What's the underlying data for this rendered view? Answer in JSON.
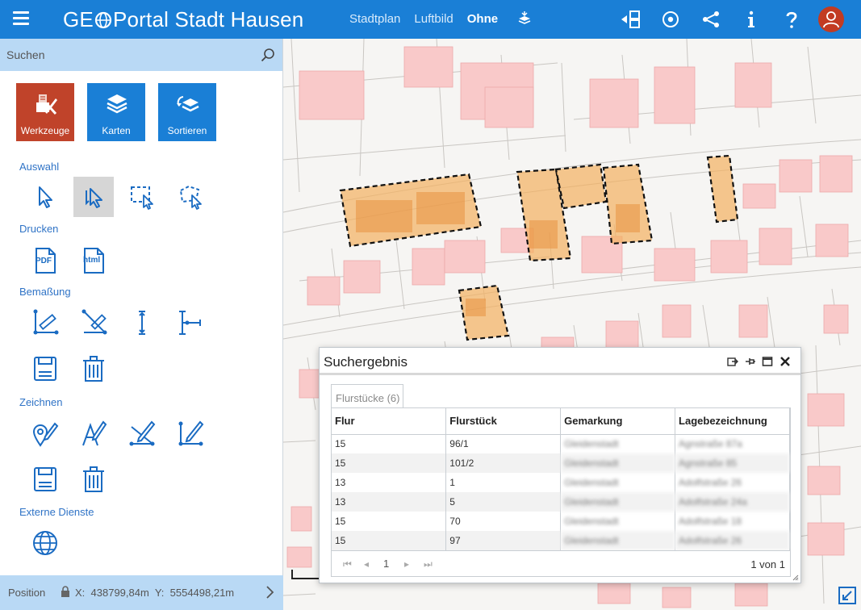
{
  "header": {
    "brand_prefix": "GE",
    "brand_suffix": "Portal Stadt Hausen",
    "nav": [
      {
        "label": "Stadtplan",
        "active": false
      },
      {
        "label": "Luftbild",
        "active": false
      },
      {
        "label": "Ohne",
        "active": true
      }
    ],
    "icons": [
      "menu-icon",
      "layers-icon",
      "panel-toggle-icon",
      "target-icon",
      "share-icon",
      "info-icon",
      "help-icon",
      "user-icon"
    ]
  },
  "search": {
    "placeholder": "Suchen"
  },
  "tabs": [
    {
      "label": "Werkzeuge",
      "color": "#c0432a"
    },
    {
      "label": "Karten",
      "color": "#1a7fd6"
    },
    {
      "label": "Sortieren",
      "color": "#1a7fd6"
    }
  ],
  "sections": {
    "auswahl": "Auswahl",
    "drucken": "Drucken",
    "bemassung": "Bemaßung",
    "zeichnen": "Zeichnen",
    "externe": "Externe Dienste"
  },
  "print_labels": {
    "pdf": "PDF",
    "html": "html"
  },
  "status": {
    "label": "Position",
    "x_label": "X:",
    "x_value": "438799,84m",
    "y_label": "Y:",
    "y_value": "5554498,21m"
  },
  "dialog": {
    "title": "Suchergebnis",
    "tab_label": "Flurstücke (6)",
    "columns": [
      "Flur",
      "Flurstück",
      "Gemarkung",
      "Lagebezeichnung"
    ],
    "rows": [
      {
        "flur": "15",
        "flurstueck": "96/1",
        "gemarkung": "Gleidenstadt",
        "lage": "Agnstraße 87a"
      },
      {
        "flur": "15",
        "flurstueck": "101/2",
        "gemarkung": "Gleidenstadt",
        "lage": "Agnstraße 85"
      },
      {
        "flur": "13",
        "flurstueck": "1",
        "gemarkung": "Gleidenstadt",
        "lage": "Adolfstraße 26"
      },
      {
        "flur": "13",
        "flurstueck": "5",
        "gemarkung": "Gleidenstadt",
        "lage": "Adolfstraße 24a"
      },
      {
        "flur": "15",
        "flurstueck": "70",
        "gemarkung": "Gleidenstadt",
        "lage": "Adolfstraße 18"
      },
      {
        "flur": "15",
        "flurstueck": "97",
        "gemarkung": "Gleidenstadt",
        "lage": "Adolfstraße 26"
      }
    ],
    "page": "1",
    "page_count": "1 von 1"
  },
  "colors": {
    "brand": "#1a7fd6",
    "accent": "#c0432a",
    "sidebar_tint": "#b9d9f5",
    "section_title": "#2f73c6",
    "highlight_fill": "#f3b05f",
    "building": "#f9c9c9"
  }
}
